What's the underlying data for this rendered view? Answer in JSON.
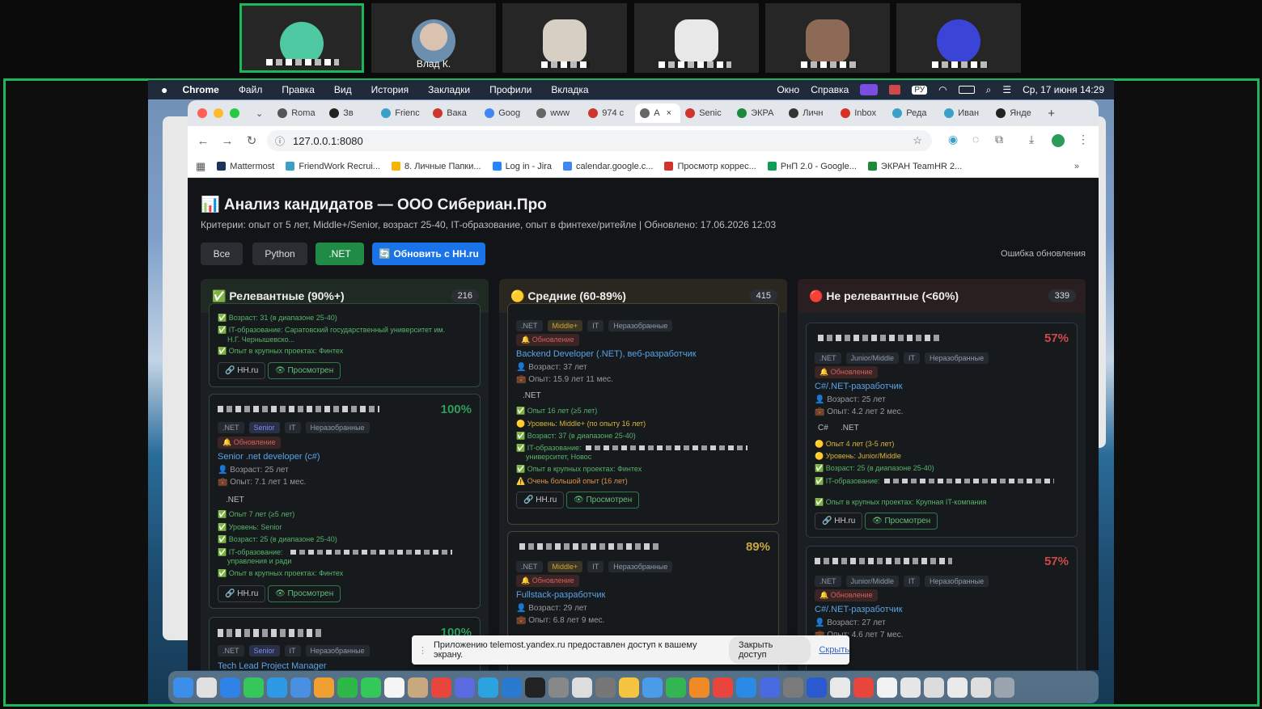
{
  "participants": [
    {
      "name": "",
      "color": "#4ec9a2",
      "active": true
    },
    {
      "name": "Влад К.",
      "color": "#b3a399",
      "active": false
    },
    {
      "name": "",
      "color": "#d8cfc4",
      "active": false
    },
    {
      "name": "",
      "color": "#e8e8e8",
      "active": false
    },
    {
      "name": "",
      "color": "#8c6a55",
      "active": false
    },
    {
      "name": "",
      "color": "#3a45d8",
      "active": false
    }
  ],
  "menubar": {
    "apple": "",
    "app": "Chrome",
    "items": [
      "Файл",
      "Правка",
      "Вид",
      "История",
      "Закладки",
      "Профили",
      "Вкладка"
    ],
    "right": [
      "Окно",
      "Справка",
      "РУ",
      "Ср, 17 июня  14:29"
    ]
  },
  "browser": {
    "tabs": [
      {
        "label": "Roma",
        "color": "#555"
      },
      {
        "label": "Зв",
        "color": "#222"
      },
      {
        "label": "Frienc",
        "color": "#3aa0c8"
      },
      {
        "label": "Вака",
        "color": "#d0342c"
      },
      {
        "label": "Goog",
        "color": "#4285f4"
      },
      {
        "label": "www",
        "color": "#666"
      },
      {
        "label": "974 с",
        "color": "#d0342c"
      },
      {
        "label": "А",
        "color": "#666",
        "active": true
      },
      {
        "label": "Senic",
        "color": "#d0342c"
      },
      {
        "label": "ЭКРА",
        "color": "#1b8a3b"
      },
      {
        "label": "Личн",
        "color": "#333"
      },
      {
        "label": "Inbox",
        "color": "#d93025"
      },
      {
        "label": "Реда",
        "color": "#3aa0c8"
      },
      {
        "label": "Иван",
        "color": "#3aa0c8"
      },
      {
        "label": "Янде",
        "color": "#222"
      }
    ],
    "close_tab": "×",
    "new_tab": "+",
    "url": "127.0.0.1:8080",
    "bookmarks": [
      {
        "label": "Mattermost",
        "color": "#1e325c"
      },
      {
        "label": "FriendWork Recrui...",
        "color": "#3aa0c8"
      },
      {
        "label": "8. Личные Папки...",
        "color": "#f4b400"
      },
      {
        "label": "Log in - Jira",
        "color": "#2684ff"
      },
      {
        "label": "calendar.google.c...",
        "color": "#4285f4"
      },
      {
        "label": "Просмотр коррес...",
        "color": "#d0342c"
      },
      {
        "label": "РнП 2.0  - Google...",
        "color": "#0f9d58"
      },
      {
        "label": "ЭКРАН TeamHR 2...",
        "color": "#1b8a3b"
      }
    ]
  },
  "page": {
    "title": "📊 Анализ кандидатов — ООО Сибериан.Про",
    "subtitle": "Критерии: опыт от 5 лет, Middle+/Senior, возраст 25-40, IT-образование, опыт в финтехе/ритейле | Обновлено: 17.06.2026 12:03",
    "filters": [
      "Все",
      "Python",
      ".NET"
    ],
    "refresh_button": "🔄 Обновить с HH.ru",
    "error_text": "Ошибка обновления"
  },
  "columns": [
    {
      "title": "✅ Релевантные (90%+)",
      "count": "216",
      "color": "#1f2a22"
    },
    {
      "title": "🟡 Средние (60-89%)",
      "count": "415",
      "color": "#2a2620"
    },
    {
      "title": "🔴 Не релевантные (<60%)",
      "count": "339",
      "color": "#2a1f20"
    }
  ],
  "col1": {
    "card0": {
      "lines": [
        "✅ Возраст: 31 (в диапазоне 25-40)",
        "✅ IT-образование: Саратовский государственный университет им.",
        "Н.Г. Чернышевско...",
        "✅ Опыт в крупных проектах: Финтех"
      ],
      "hh": "🔗 HH.ru",
      "seen": "👁 Просмотрен"
    },
    "card1": {
      "pct": "100%",
      "tags": [
        ".NET",
        "Senior",
        "IT",
        "Неразобранные"
      ],
      "update": "🔔 Обновление",
      "role": "Senior .net developer (c#)",
      "age": "👤 Возраст: 25 лет",
      "exp": "💼 Опыт: 7.1 лет 1 мес.",
      "skill": ".NET",
      "lines": [
        "✅ Опыт 7 лет (≥5 лет)",
        "✅ Уровень: Senior",
        "✅ Возраст: 25 (в диапазоне 25-40)",
        "✅ IT-образование:",
        "управления и ради",
        "✅ Опыт в крупных проектах: Финтех"
      ],
      "hh": "🔗 HH.ru",
      "seen": "👁 Просмотрен"
    },
    "card2": {
      "pct": "100%",
      "tags": [
        ".NET",
        "Senior",
        "IT",
        "Неразобранные"
      ],
      "role": "Tech Lead Project Manager"
    }
  },
  "col2": {
    "card0": {
      "tags": [
        ".NET",
        "Middle+",
        "IT",
        "Неразобранные"
      ],
      "update": "🔔 Обновление",
      "role": "Backend Developer (.NET), веб-разработчик",
      "age": "👤 Возраст: 37 лет",
      "exp": "💼 Опыт: 15.9 лет 11 мес.",
      "skill": ".NET",
      "lines": [
        "✅ Опыт 16 лет (≥5 лет)",
        "🟡 Уровень: Middle+ (по опыту 16 лет)",
        "✅ Возраст: 37 (в диапазоне 25-40)",
        "✅ IT-образование:",
        "университет, Новос",
        "✅ Опыт в крупных проектах: Финтех",
        "⚠️ Очень большой опыт (16 лет)"
      ],
      "hh": "🔗 HH.ru",
      "seen": "👁 Просмотрен"
    },
    "card1": {
      "pct": "89%",
      "tags": [
        ".NET",
        "Middle+",
        "IT",
        "Неразобранные"
      ],
      "update": "🔔 Обновление",
      "role": "Fullstack-разработчик",
      "age": "👤 Возраст: 29 лет",
      "exp": "💼 Опыт: 6.8 лет 9 мес."
    }
  },
  "col3": {
    "card0": {
      "pct": "57%",
      "tags": [
        ".NET",
        "Junior/Middle",
        "IT",
        "Неразобранные"
      ],
      "update": "🔔 Обновление",
      "role": "C#/.NET-разработчик",
      "age": "👤 Возраст: 25 лет",
      "exp": "💼 Опыт: 4.2 лет 2 мес.",
      "skills": [
        "C#",
        ".NET"
      ],
      "lines": [
        "🟡 Опыт 4 лет (3-5 лет)",
        "🟡 Уровень: Junior/Middle",
        "✅ Возраст: 25 (в диапазоне 25-40)",
        "✅ IT-образование:",
        "✅ Опыт в крупных проектах: Крупная IT-компания"
      ],
      "hh": "🔗 HH.ru",
      "seen": "👁 Просмотрен"
    },
    "card1": {
      "pct": "57%",
      "tags": [
        ".NET",
        "Junior/Middle",
        "IT",
        "Неразобранные"
      ],
      "update": "🔔 Обновление",
      "role": "C#/.NET-разработчик",
      "age": "👤 Возраст: 27 лет",
      "exp": "💼 Опыт: 4.6 лет 7 мес."
    }
  },
  "share_bar": {
    "text": "Приложению telemost.yandex.ru предоставлен доступ к вашему экрану.",
    "stop": "Закрыть доступ",
    "hide": "Скрыть"
  }
}
